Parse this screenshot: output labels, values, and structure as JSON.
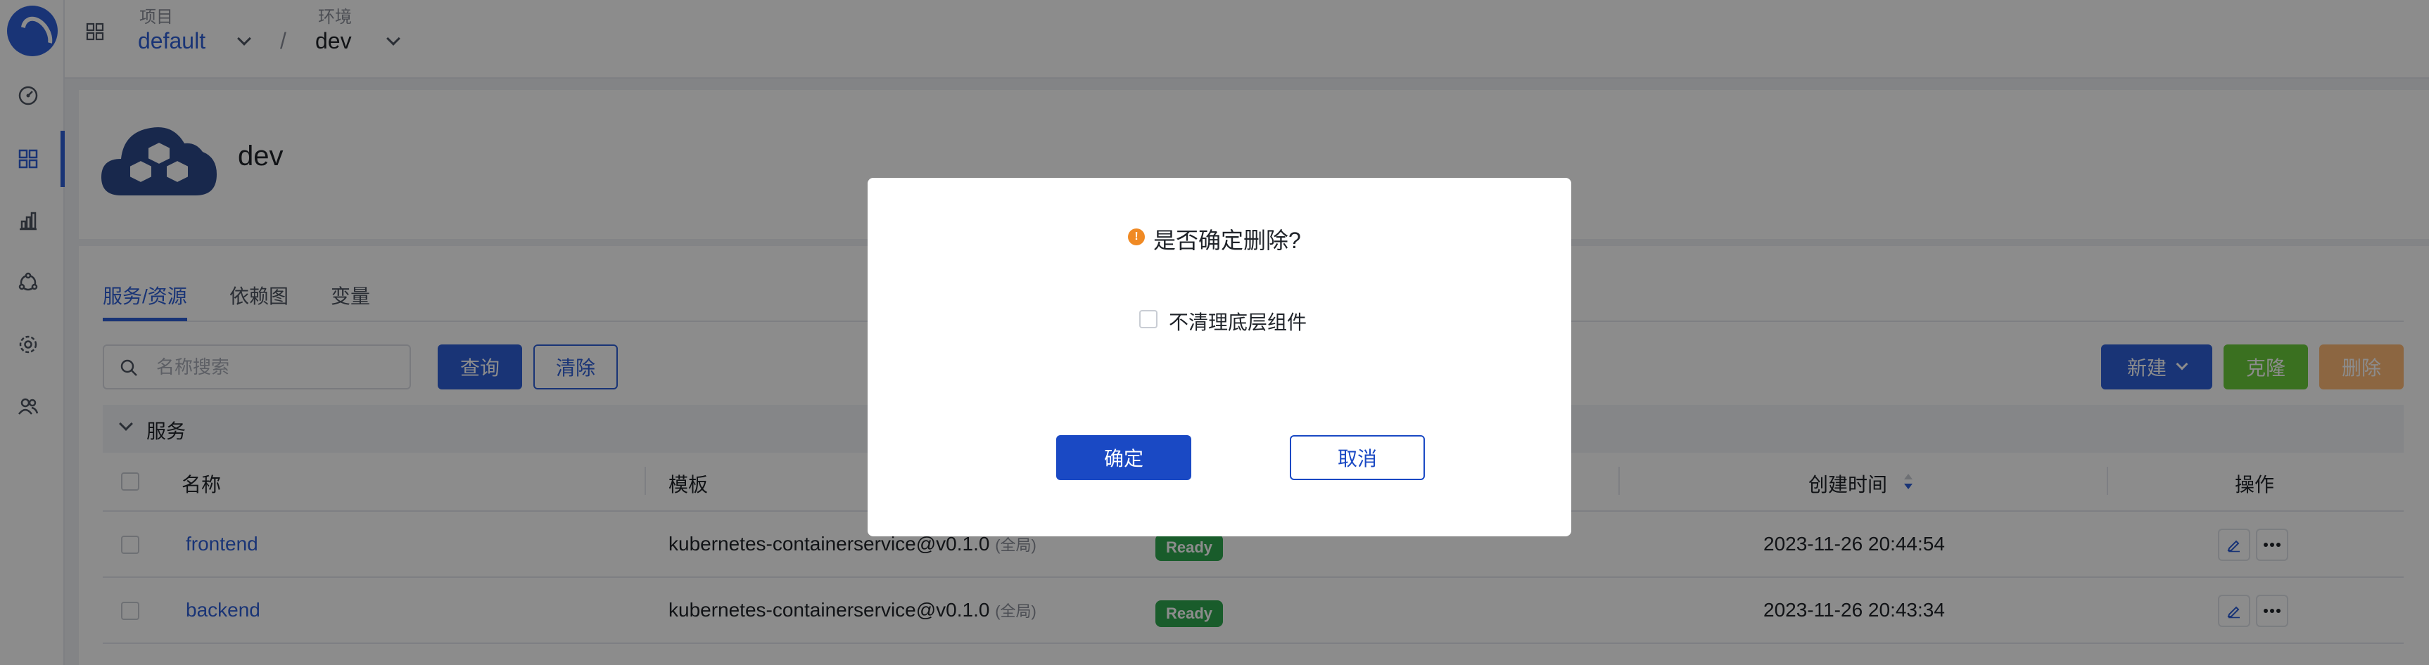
{
  "topbar": {
    "project_label": "项目",
    "project_value": "default",
    "separator": "/",
    "env_label": "环境",
    "env_value": "dev"
  },
  "environment": {
    "name": "dev"
  },
  "tabs": [
    {
      "label": "服务/资源",
      "active": true
    },
    {
      "label": "依赖图",
      "active": false
    },
    {
      "label": "变量",
      "active": false
    }
  ],
  "toolbar": {
    "search_placeholder": "名称搜索",
    "query_label": "查询",
    "clear_label": "清除",
    "new_label": "新建",
    "clone_label": "克隆",
    "delete_label": "删除"
  },
  "group": {
    "title": "服务"
  },
  "table": {
    "columns": {
      "name": "名称",
      "template": "模板",
      "created": "创建时间",
      "actions": "操作"
    },
    "rows": [
      {
        "name": "frontend",
        "template": "kubernetes-containerservice@v0.1.0",
        "scope": "(全局)",
        "status": "Ready",
        "created": "2023-11-26 20:44:54"
      },
      {
        "name": "backend",
        "template": "kubernetes-containerservice@v0.1.0",
        "scope": "(全局)",
        "status": "Ready",
        "created": "2023-11-26 20:43:34"
      }
    ]
  },
  "modal": {
    "title": "是否确定删除?",
    "warn_symbol": "!",
    "checkbox_label": "不清理底层组件",
    "confirm_label": "确定",
    "cancel_label": "取消"
  },
  "colors": {
    "accent": "#2f5fd8",
    "status_ready": "#2ea84f",
    "warning": "#f08a24",
    "clone": "#52c41a",
    "delete": "#ffb469"
  },
  "icons": [
    "logo-icon",
    "dashboard-icon",
    "apps-icon",
    "chart-icon",
    "flow-icon",
    "settings-icon",
    "users-icon",
    "grid-icon",
    "search-icon",
    "chevron-down-icon",
    "sort-icon",
    "edit-icon",
    "more-icon",
    "warning-icon",
    "cloud-cubes-icon"
  ]
}
